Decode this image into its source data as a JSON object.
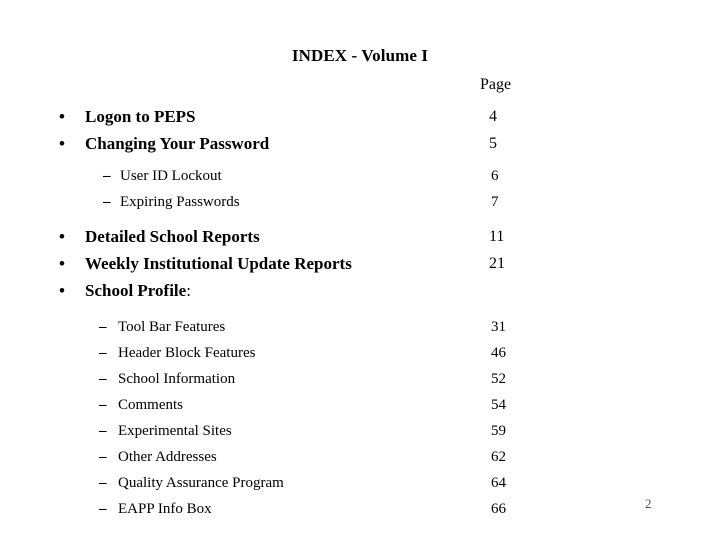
{
  "slide": {
    "title": "INDEX - Volume I",
    "page_column_header": "Page",
    "slide_number": "2",
    "background_color": "#ffffff",
    "text_color": "#000000"
  },
  "markers": {
    "bullet": "•",
    "dash": "–"
  },
  "entries": [
    {
      "level": 1,
      "label": "Logon to PEPS",
      "page": "4"
    },
    {
      "level": 1,
      "label": "Changing Your Password",
      "page": "5"
    },
    {
      "level": 2,
      "label": "User ID Lockout",
      "page": "6"
    },
    {
      "level": 2,
      "label": "Expiring Passwords",
      "page": "7"
    },
    {
      "level": 1,
      "label": "Detailed School Reports",
      "page": "11"
    },
    {
      "level": 1,
      "label": "Weekly Institutional Update Reports",
      "page": "21"
    },
    {
      "level": 1,
      "label": "School Profile",
      "suffix": ":",
      "page": ""
    },
    {
      "level": 2,
      "label": "Tool Bar Features",
      "page": "31"
    },
    {
      "level": 2,
      "label": "Header Block Features",
      "page": "46"
    },
    {
      "level": 2,
      "label": "School Information",
      "page": "52"
    },
    {
      "level": 2,
      "label": "Comments",
      "page": "54"
    },
    {
      "level": 2,
      "label": "Experimental Sites",
      "page": "59"
    },
    {
      "level": 2,
      "label": "Other Addresses",
      "page": "62"
    },
    {
      "level": 2,
      "label": "Quality Assurance Program",
      "page": "64"
    },
    {
      "level": 2,
      "label": "EAPP Info Box",
      "page": "66"
    }
  ]
}
